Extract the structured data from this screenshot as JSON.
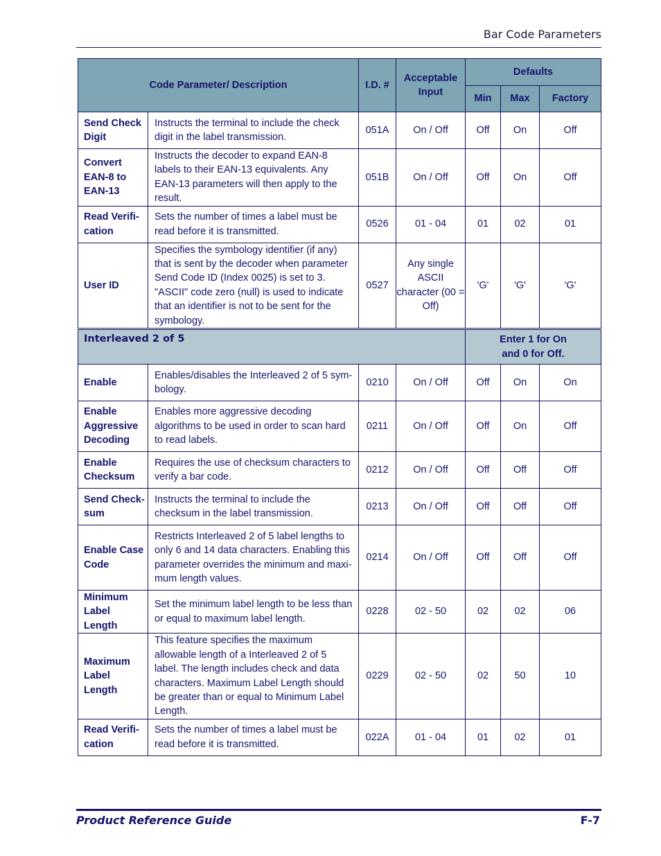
{
  "header": {
    "running_title": "Bar Code Parameters"
  },
  "table": {
    "headers": {
      "code_parameter": "Code Parameter/ Description",
      "id": "I.D. #",
      "acceptable_input": "Acceptable Input",
      "defaults": "Defaults",
      "min": "Min",
      "max": "Max",
      "factory": "Factory"
    },
    "rows_top": [
      {
        "name": "Send Check Digit",
        "description": "Instructs the terminal to include the check digit in the label transmission.",
        "id": "051A",
        "input": "On / Off",
        "min": "Off",
        "max": "On",
        "factory": "Off"
      },
      {
        "name": "Convert EAN-8 to EAN-13",
        "description": "Instructs the decoder to expand EAN-8 labels to their EAN-13 equivalents. Any EAN-13 parameters will then apply to the result.",
        "id": "051B",
        "input": "On / Off",
        "min": "Off",
        "max": "On",
        "factory": "Off"
      },
      {
        "name": "Read Verifi-cation",
        "description": "Sets the number of times a label must be read before it is transmitted.",
        "id": "0526",
        "input": "01 - 04",
        "min": "01",
        "max": "02",
        "factory": "01"
      },
      {
        "name": "User ID",
        "description": "Specifies the symbology identifier (if any) that is sent by the decoder when parameter Send Code ID (Index 0025) is set to 3. \"ASCII\" code zero (null) is used to indicate that an identifier is not to be sent for the symbology.",
        "id": "0527",
        "input": "Any single ASCII character (00 = Off)",
        "min": "'G'",
        "max": "'G'",
        "factory": "'G'"
      }
    ],
    "section": {
      "title": "Interleaved 2 of 5",
      "note_line1": "Enter 1 for On",
      "note_line2": "and 0 for Off."
    },
    "rows_section": [
      {
        "name": "Enable",
        "description": "Enables/disables the Interleaved 2 of 5 sym-bology.",
        "id": "0210",
        "input": "On / Off",
        "min": "Off",
        "max": "On",
        "factory": "On"
      },
      {
        "name": "Enable Aggressive Decoding",
        "description": "Enables more aggressive decoding algorithms to be used in order to scan hard to read labels.",
        "id": "0211",
        "input": "On / Off",
        "min": "Off",
        "max": "On",
        "factory": "Off"
      },
      {
        "name": "Enable Checksum",
        "description": "Requires the use of checksum characters to verify a bar code.",
        "id": "0212",
        "input": "On / Off",
        "min": "Off",
        "max": "Off",
        "factory": "Off"
      },
      {
        "name": "Send Check-sum",
        "description": "Instructs the terminal to include the checksum in the label transmission.",
        "id": "0213",
        "input": "On / Off",
        "min": "Off",
        "max": "Off",
        "factory": "Off"
      },
      {
        "name": "Enable Case Code",
        "description": "Restricts Interleaved 2 of 5 label lengths to only 6 and 14 data characters. Enabling this parameter overrides the minimum and maxi-mum length values.",
        "id": "0214",
        "input": "On / Off",
        "min": "Off",
        "max": "Off",
        "factory": "Off"
      },
      {
        "name": "Minimum Label Length",
        "description": "Set the minimum label length to be less than or equal to maximum label length.",
        "id": "0228",
        "input": "02 - 50",
        "min": "02",
        "max": "02",
        "factory": "06"
      },
      {
        "name": "Maximum Label Length",
        "description": "This feature specifies the maximum allowable length of a Interleaved 2 of 5 label. The length includes check and data characters. Maximum Label Length should be greater than or equal to Minimum Label Length.",
        "id": "0229",
        "input": "02 - 50",
        "min": "02",
        "max": "50",
        "factory": "10"
      },
      {
        "name": "Read Verifi-cation",
        "description": "Sets the number of times a label must be read before it is transmitted.",
        "id": "022A",
        "input": "01 - 04",
        "min": "01",
        "max": "02",
        "factory": "01"
      }
    ]
  },
  "footer": {
    "guide_title": "Product Reference Guide",
    "page_number": "F-7"
  }
}
